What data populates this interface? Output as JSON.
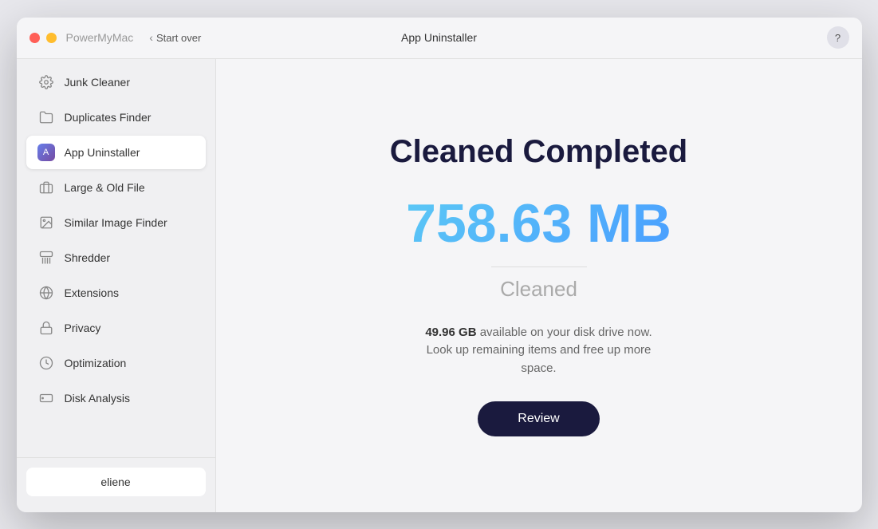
{
  "titleBar": {
    "appName": "PowerMyMac",
    "startOverLabel": "Start over",
    "centerTitle": "App Uninstaller",
    "helpIcon": "?"
  },
  "sidebar": {
    "items": [
      {
        "id": "junk-cleaner",
        "label": "Junk Cleaner",
        "icon": "gear",
        "active": false
      },
      {
        "id": "duplicates-finder",
        "label": "Duplicates Finder",
        "icon": "folder",
        "active": false
      },
      {
        "id": "app-uninstaller",
        "label": "App Uninstaller",
        "icon": "app",
        "active": true
      },
      {
        "id": "large-old-file",
        "label": "Large & Old File",
        "icon": "briefcase",
        "active": false
      },
      {
        "id": "similar-image-finder",
        "label": "Similar Image Finder",
        "icon": "image",
        "active": false
      },
      {
        "id": "shredder",
        "label": "Shredder",
        "icon": "shredder",
        "active": false
      },
      {
        "id": "extensions",
        "label": "Extensions",
        "icon": "extensions",
        "active": false
      },
      {
        "id": "privacy",
        "label": "Privacy",
        "icon": "lock",
        "active": false
      },
      {
        "id": "optimization",
        "label": "Optimization",
        "icon": "optimization",
        "active": false
      },
      {
        "id": "disk-analysis",
        "label": "Disk Analysis",
        "icon": "disk",
        "active": false
      }
    ],
    "user": {
      "name": "eliene"
    }
  },
  "content": {
    "title": "Cleaned Completed",
    "amount": "758.63 MB",
    "cleanedLabel": "Cleaned",
    "diskInfo": {
      "size": "49.96 GB",
      "description": " available on your disk drive now. Look up remaining items and free up more space."
    },
    "reviewButton": "Review"
  }
}
